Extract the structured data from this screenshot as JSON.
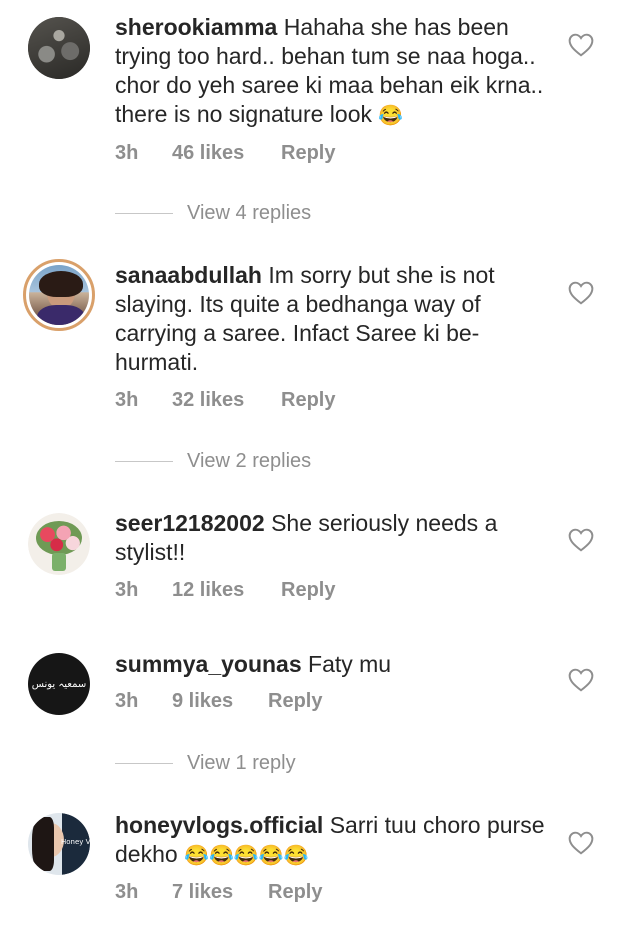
{
  "comments": [
    {
      "username": "sherookiamma",
      "text": "Hahaha she has been trying too hard.. behan tum se naa hoga.. chor do yeh saree ki maa behan eik krna.. there is no signature look",
      "emoji": "😂",
      "time": "3h",
      "likes": "46 likes",
      "reply": "Reply",
      "view_replies": "View 4 replies"
    },
    {
      "username": "sanaabdullah",
      "text": "Im sorry but she is not slaying. Its quite a bedhanga way of carrying a saree. Infact Saree ki be-hurmati.",
      "time": "3h",
      "likes": "32 likes",
      "reply": "Reply",
      "view_replies": "View 2 replies"
    },
    {
      "username": "seer12182002",
      "text": "She seriously needs a stylist!!",
      "time": "3h",
      "likes": "12 likes",
      "reply": "Reply"
    },
    {
      "username": "summya_younas",
      "text": "Faty mu",
      "avatar_text": "سمعیہ یونس",
      "time": "3h",
      "likes": "9 likes",
      "reply": "Reply",
      "view_replies": "View 1 reply"
    },
    {
      "username": "honeyvlogs.official",
      "text": "Sarri tuu choro purse dekho",
      "emoji": "😂😂😂😂😂",
      "avatar_text": "Honey Vlogs",
      "time": "3h",
      "likes": "7 likes",
      "reply": "Reply"
    }
  ],
  "colors": {
    "text": "#262626",
    "meta": "#8e8e8e",
    "divider": "#c7c7c7",
    "ring": "#d9a06a"
  },
  "icons": {
    "like": "heart-outline-icon"
  }
}
